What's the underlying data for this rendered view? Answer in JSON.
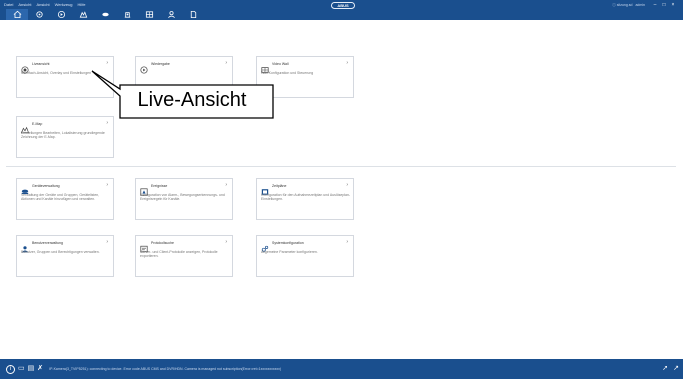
{
  "menu": [
    "Datei",
    "Ansicht",
    "Ansicht",
    "Werkzeug",
    "Hilfe"
  ],
  "logo": "ABUS",
  "top_right": {
    "item1": "ⓘ  sitzung.sd",
    "item2": "admin"
  },
  "toolbar": [
    {
      "name": "home-icon",
      "glyph": "⌂"
    },
    {
      "name": "settings-icon",
      "glyph": "⚙"
    },
    {
      "name": "playback-icon",
      "glyph": "⊕"
    },
    {
      "name": "emap-icon",
      "glyph": "△"
    },
    {
      "name": "storage-icon",
      "glyph": "▬"
    },
    {
      "name": "events-icon",
      "glyph": "▲"
    },
    {
      "name": "video-wall-icon",
      "glyph": "▦"
    },
    {
      "name": "user-icon",
      "glyph": "☺"
    },
    {
      "name": "file-icon",
      "glyph": "▯"
    }
  ],
  "top_cards": [
    {
      "title": "Liveansicht",
      "desc": "Mehrfach-Ansicht, Overlay und Einstellungen",
      "icon": "camera-icon"
    },
    {
      "title": "Wiedergabe",
      "desc": "",
      "icon": "playback-icon"
    },
    {
      "title": "Video Wall",
      "desc": "Wall Konfiguration und Steuerung",
      "icon": "video-wall-icon"
    },
    {
      "title": "E-Map",
      "desc": "Einstellungen Bearbeiten, Lokalisierung grundlegende Zeichnung der E-Map.",
      "icon": "emap-icon"
    }
  ],
  "bottom_cards": [
    {
      "title": "Geräteverwaltung",
      "desc": "Verwaltung der Geräte und Gruppen, Gerätelisten, Aktionen und Kanäle hinzufügen und verwalten.",
      "icon": "device-icon"
    },
    {
      "title": "Ereignisse",
      "desc": "Konfiguration von Alarm-, Bewegungserkennungs- und Ereignisregeln für Kanäle.",
      "icon": "event-icon"
    },
    {
      "title": "Zeitpläne",
      "desc": "Konfiguration für den Aufnahmezeitplan und Auslöseplan-Einstellungen.",
      "icon": "schedule-icon"
    },
    {
      "title": "Benutzerverwaltung",
      "desc": "Benutzer, Gruppen und Berechtigungen verwalten.",
      "icon": "user-management-icon"
    },
    {
      "title": "Protokollsuche",
      "desc": "Server- und Client-Protokolle anzeigen, Protokolle exportieren.",
      "icon": "log-search-icon"
    },
    {
      "title": "Systemkonfiguration",
      "desc": "Allgemeine Parameter konfigurieren.",
      "icon": "system-config-icon"
    }
  ],
  "callout": "Live-Ansicht",
  "status": {
    "text": "IP-Kamera(3_TVIP5251): connecting to device. Error code ABUS CMS and DVR/HDN. Camera is managed not subscription(Error=ret=1xxxxxxxxxxx)"
  }
}
